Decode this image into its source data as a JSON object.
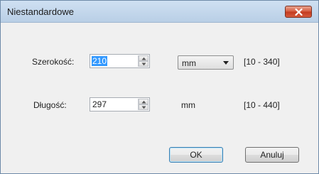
{
  "window": {
    "title": "Niestandardowe",
    "close_icon": "close-icon"
  },
  "width_row": {
    "label": "Szerokość:",
    "value": "210",
    "unit": "mm",
    "range": "[10 - 340]"
  },
  "length_row": {
    "label": "Długość:",
    "value": "297",
    "unit": "mm",
    "range": "[10 - 440]"
  },
  "buttons": {
    "ok": "OK",
    "cancel": "Anuluj"
  },
  "colors": {
    "titlebar": "#b9cfe6",
    "close": "#c23a1e",
    "selection": "#3399ff",
    "default_button_border": "#3c7fb1"
  }
}
